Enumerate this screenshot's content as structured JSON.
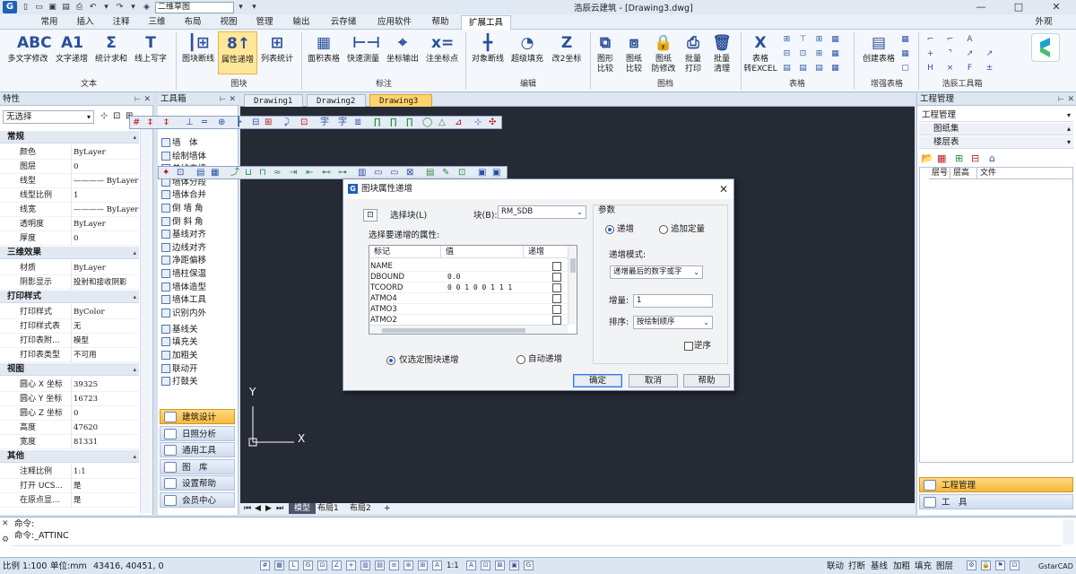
{
  "app": {
    "title": "浩辰云建筑 - [Drawing3.dwg]",
    "workspace": "二维草图",
    "logo": "G",
    "win_min": "—",
    "win_max": "□",
    "win_close": "✕",
    "search_hint": "外观"
  },
  "menu_tabs": [
    "常用",
    "插入",
    "注释",
    "三维",
    "布局",
    "视图",
    "管理",
    "输出",
    "云存储",
    "应用软件",
    "帮助",
    "扩展工具"
  ],
  "active_menu_tab": "扩展工具",
  "ribbon": {
    "buttons": [
      {
        "label1": "多文字修改",
        "label2": "",
        "icon": "ABC"
      },
      {
        "label1": "文字递增",
        "label2": "",
        "icon": "A1"
      },
      {
        "label1": "统计求和",
        "label2": "",
        "icon": "Σ"
      },
      {
        "label1": "线上写字",
        "label2": "",
        "icon": "T"
      },
      {
        "label1": "图块断线",
        "label2": "",
        "icon": "┃⊞"
      },
      {
        "label1": "属性递增",
        "label2": "",
        "icon": "8↑"
      },
      {
        "label1": "列表统计",
        "label2": "",
        "icon": "⊞"
      },
      {
        "label1": "面积表格",
        "label2": "",
        "icon": "▦"
      },
      {
        "label1": "快速测量",
        "label2": "",
        "icon": "⊢⊣"
      },
      {
        "label1": "坐标输出",
        "label2": "",
        "icon": "⌖"
      },
      {
        "label1": "注坐标点",
        "label2": "",
        "icon": "x="
      },
      {
        "label1": "对象断线",
        "label2": "",
        "icon": "╋"
      },
      {
        "label1": "超级填充",
        "label2": "",
        "icon": "◔"
      },
      {
        "label1": "改2坐标",
        "label2": "",
        "icon": "Z"
      },
      {
        "label1": "图形",
        "label2": "比较",
        "icon": "⧉"
      },
      {
        "label1": "图纸",
        "label2": "比较",
        "icon": "⧈"
      },
      {
        "label1": "图纸",
        "label2": "防修改",
        "icon": "🔒"
      },
      {
        "label1": "批量",
        "label2": "打印",
        "icon": "⎙"
      },
      {
        "label1": "批量",
        "label2": "清理",
        "icon": "🗑"
      },
      {
        "label1": "表格",
        "label2": "转EXCEL",
        "icon": "X"
      },
      {
        "label1": "创建表格",
        "label2": "",
        "icon": "▤"
      }
    ],
    "groups": [
      "文本",
      "图块",
      "标注",
      "编辑",
      "图档",
      "表格",
      "增强表格",
      "浩辰工具箱"
    ]
  },
  "properties_panel": {
    "title": "特性",
    "selection": "无选择",
    "sections": [
      {
        "name": "常规",
        "rows": [
          [
            "颜色",
            "ByLayer"
          ],
          [
            "图层",
            "0"
          ],
          [
            "线型",
            "———— ByLayer"
          ],
          [
            "线型比例",
            "1"
          ],
          [
            "线宽",
            "———— ByLayer"
          ],
          [
            "透明度",
            "ByLayer"
          ],
          [
            "厚度",
            "0"
          ]
        ]
      },
      {
        "name": "三维效果",
        "rows": [
          [
            "材质",
            "ByLayer"
          ],
          [
            "阴影显示",
            "投射和接收阴影"
          ]
        ]
      },
      {
        "name": "打印样式",
        "rows": [
          [
            "打印样式",
            "ByColor"
          ],
          [
            "打印样式表",
            "无"
          ],
          [
            "打印表附...",
            "模型"
          ],
          [
            "打印表类型",
            "不可用"
          ]
        ]
      },
      {
        "name": "视图",
        "rows": [
          [
            "圆心 X 坐标",
            "39325"
          ],
          [
            "圆心 Y 坐标",
            "16723"
          ],
          [
            "圆心 Z 坐标",
            "0"
          ],
          [
            "高度",
            "47620"
          ],
          [
            "宽度",
            "81331"
          ]
        ]
      },
      {
        "name": "其他",
        "rows": [
          [
            "注释比例",
            "1:1"
          ],
          [
            "打开 UCS...",
            "是"
          ],
          [
            "在原点显...",
            "是"
          ]
        ]
      }
    ]
  },
  "toolbox": {
    "title": "工具箱",
    "items": [
      "墙　体",
      "绘制墙体",
      "单线变墙",
      "墙体分段",
      "墙体合并",
      "倒 墙 角",
      "倒 斜 角",
      "基线对齐",
      "边线对齐",
      "净距偏移",
      "墙柱保温",
      "墙体造型",
      "墙体工具",
      "识别内外",
      "基线关",
      "填充关",
      "加粗关",
      "联动开",
      "打鼓关"
    ],
    "categories": [
      "建筑设计",
      "日照分析",
      "通用工具",
      "图　库",
      "设置帮助",
      "会员中心"
    ]
  },
  "drawing_tabs": [
    "Drawing1",
    "Drawing2",
    "Drawing3"
  ],
  "active_drawing_tab": "Drawing3",
  "layout_tabs": [
    "模型",
    "布局1",
    "布局2",
    "+"
  ],
  "ucs": {
    "y": "Y",
    "x": "X"
  },
  "dialog": {
    "title": "图块属性递增",
    "select_block": "选择块(L)",
    "block_label": "块(B):",
    "block_value": "RM_SDB",
    "table_label": "选择要递增的属性:",
    "headers": [
      "标记",
      "值",
      "递增"
    ],
    "rows": [
      [
        "NAME",
        ""
      ],
      [
        "DBOUND",
        "0.0"
      ],
      [
        "TCOORD",
        "0 0 1 0 0 1 1 1"
      ],
      [
        "ATMO4",
        ""
      ],
      [
        "ATMO3",
        ""
      ],
      [
        "ATMO2",
        ""
      ]
    ],
    "params_label": "参数",
    "radio_increment": "递增",
    "radio_append": "追加定量",
    "mode_label": "递增模式:",
    "mode_value": "递增最后的数字或字",
    "step_label": "增量:",
    "step_value": "1",
    "order_label": "排序:",
    "order_value": "按绘制顺序",
    "reverse_label": "逆序",
    "only_selected": "仅选定图块递增",
    "auto_increment": "自动递增",
    "ok": "确定",
    "cancel": "取消",
    "help": "帮助"
  },
  "project_panel": {
    "title": "工程管理",
    "dropdown": "工程管理",
    "sheet_set": "图纸集",
    "floor_table": "楼层表",
    "cols": [
      "层号",
      "层高",
      "文件"
    ],
    "tab_project": "工程管理",
    "tab_tools": "工　具"
  },
  "command": {
    "line1": "命令:",
    "line2": "命令:_ATTINC"
  },
  "status": {
    "scale": "比例 1:100",
    "unit": "单位:mm",
    "coords": "43416, 40451, 0",
    "modes": [
      "联动",
      "打断",
      "基线",
      "加粗",
      "填充",
      "图层"
    ],
    "product": "GstarCAD"
  }
}
